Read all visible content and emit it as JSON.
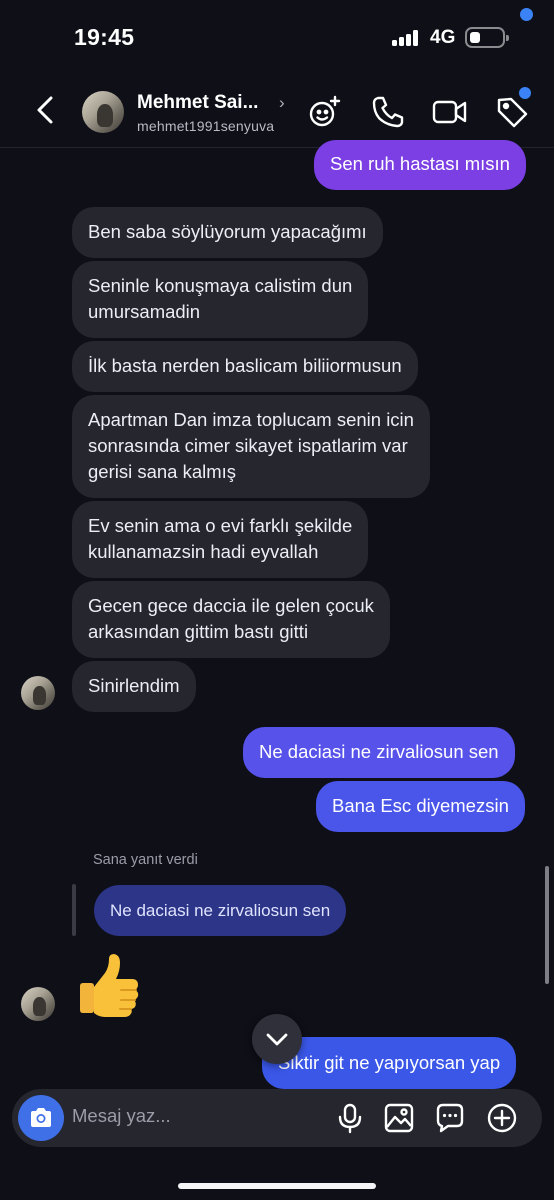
{
  "status_bar": {
    "time": "19:45",
    "network": "4G"
  },
  "header": {
    "name": "Mehmet Sai...",
    "chevron": "›",
    "username": "mehmet1991senyuva",
    "icons": [
      "effects-icon",
      "phone-icon",
      "video-camera-icon",
      "tag-icon"
    ]
  },
  "messages": [
    {
      "from": "me",
      "text": "Sen ruh hastası mısın"
    },
    {
      "from": "them",
      "text": "Ben saba söylüyorum yapacağımı"
    },
    {
      "from": "them",
      "text": "Seninle konuşmaya calistim dun\numursamadin"
    },
    {
      "from": "them",
      "text": "İlk basta nerden baslicam biliiormusun"
    },
    {
      "from": "them",
      "text": "Apartman Dan imza toplucam senin icin\nsonrasında cimer sikayet ispatlarim var\ngerisi sana kalmış"
    },
    {
      "from": "them",
      "text": "Ev senin ama o evi farklı şekilde\nkullanamazsin hadi eyvallah"
    },
    {
      "from": "them",
      "text": "Gecen gece daccia ile gelen çocuk\narkasından gittim bastı gitti"
    },
    {
      "from": "them",
      "text": "Sinirlendim"
    },
    {
      "from": "me",
      "text": "Ne daciasi ne zirvaliosun sen"
    },
    {
      "from": "me",
      "text": "Bana Esc diyemezsin"
    },
    {
      "from": "me",
      "text": "Siktir git ne yapıyorsan yap"
    }
  ],
  "reply": {
    "label": "Sana yanıt verdi",
    "quoted": "Ne daciasi ne zirvaliosun sen"
  },
  "reaction_emoji": "thumbs-up",
  "composer": {
    "placeholder": "Mesaj yaz...",
    "icons": [
      "camera-icon",
      "microphone-icon",
      "gallery-icon",
      "sticker-icon",
      "plus-icon"
    ]
  },
  "colors": {
    "background": "#0e0f17",
    "received_bubble": "#25262e",
    "sent_gradient_top": "#7b3fe4",
    "sent_gradient_bottom": "#3a57e8",
    "accent_blue": "#3f70e8"
  }
}
